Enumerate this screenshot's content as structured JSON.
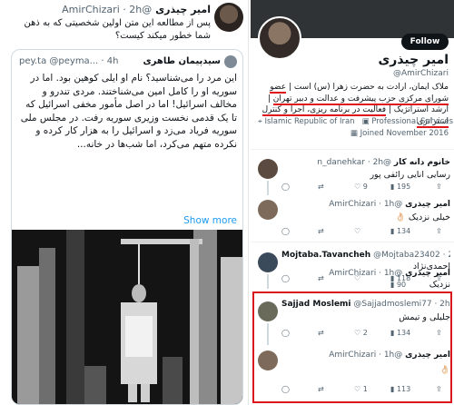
{
  "left": {
    "author_name": "امیر چیذری",
    "author_meta": "@AmirChizari · 2h",
    "tweet_text": "پس از مطالعه این متن اولین شخصیتی که به ذهن شما خطور میکند کیست؟",
    "quote": {
      "name": "سیدپیمان طاهری",
      "handle_time": "pey.ta @peyma... · 4h",
      "text": "این مرد را می‌شناسید؟ نام او ایلی کوهین بود. اما در سوریه او را کامل امین می‌شناختند. مردی تندرو و مخالف اسرائیل! اما در اصل مأمور مخفی اسرائیل که تا یک قدمی نخست وزیری سوریه رفت. در مجلس ملی سوریه فریاد می‌زد و اسرائیل را به هزار کار کرده و نکرده متهم می‌کرد، اما شب‌ها در خانه...",
      "show_more": "Show more"
    }
  },
  "profile": {
    "name": "امیر چیذری",
    "handle": "@AmirChizari",
    "follow_label": "Follow",
    "bio_part1": "ملاک ایمان، ارادت به حضرت زهرا (س) است |",
    "bio_hl1": "عضو شورای مرکزی حزب پیشرفت و عدالت و دبیر تهران",
    "bio_part2": "| ارشد استراتژیک |",
    "bio_hl2": "فعالیت در برنامه ریزی، اجرا و کنترل استراتژی",
    "category": "Professional Services",
    "location": "Islamic Republic of Iran",
    "joined": "Joined November 2016"
  },
  "replies": [
    {
      "name": "خانوم دانه کار",
      "handle": "@n_danehkar · 2h",
      "text": "رسایی انایی رائفی پور",
      "replies": "",
      "retweets": "",
      "likes": "9",
      "views": "195"
    },
    {
      "name": "امیر چیذری",
      "handle": "@AmirChizari · 1h",
      "text": "خیلی نزدیک 👌🏻",
      "replies": "",
      "retweets": "",
      "likes": "",
      "views": "134"
    },
    {
      "name": "Mojtaba.Tavancheh",
      "handle": "@Mojtaba23402 · 2h",
      "text": "احمدی‌نژاد",
      "replies": "",
      "retweets": "",
      "likes": "",
      "views": "118"
    },
    {
      "name": "امیر چیذری",
      "handle": "@AmirChizari · 1h",
      "text": "نزدیک",
      "replies": "",
      "retweets": "",
      "likes": "",
      "views": "90"
    },
    {
      "name": "Sajjad Moslemi",
      "handle": "@Sajjadmoslemi77 · 2h",
      "text": "جلیلی و تیمش",
      "replies": "",
      "retweets": "",
      "likes": "2",
      "views": "134"
    },
    {
      "name": "امیر چیذری",
      "handle": "@AmirChizari · 1h",
      "text": "👌🏻",
      "replies": "",
      "retweets": "",
      "likes": "1",
      "views": "113"
    }
  ],
  "colors": {
    "accent": "#1d9bf0",
    "highlight": "#d9181e",
    "muted": "#536471"
  }
}
